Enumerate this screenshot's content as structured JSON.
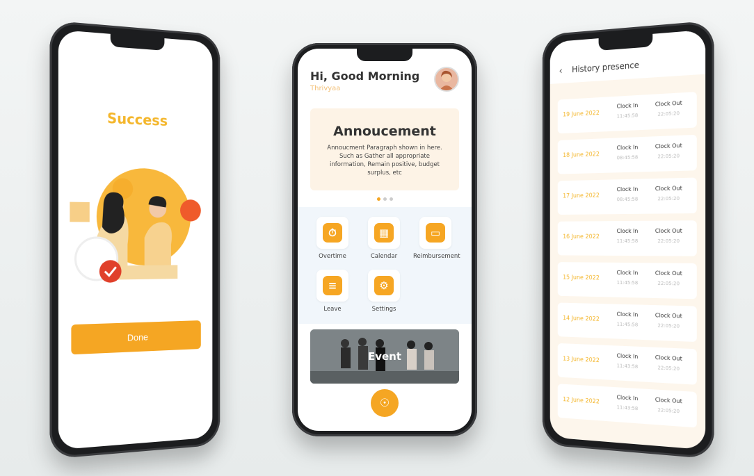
{
  "success_screen": {
    "title": "Success",
    "done_label": "Done"
  },
  "home_screen": {
    "greeting": "Hi, Good Morning",
    "user_name": "Thrivyaa",
    "announcement": {
      "title": "Annoucement",
      "text": "Annoucment Paragraph shown in here. Such as Gather all appropriate information, Remain positive, budget surplus, etc"
    },
    "menu": [
      {
        "label": "Overtime",
        "icon": "clock-plus-icon"
      },
      {
        "label": "Calendar",
        "icon": "calendar-icon"
      },
      {
        "label": "Reimbursement",
        "icon": "wallet-icon"
      },
      {
        "label": "Leave",
        "icon": "document-icon"
      },
      {
        "label": "Settings",
        "icon": "gear-icon"
      }
    ],
    "event_label": "Event"
  },
  "history_screen": {
    "title": "History presence",
    "clock_in_label": "Clock In",
    "clock_out_label": "Clock Out",
    "rows": [
      {
        "date": "19 June 2022",
        "in": "11:45:58",
        "out": "22:05:20"
      },
      {
        "date": "18 June 2022",
        "in": "08:45:58",
        "out": "22:05:20"
      },
      {
        "date": "17 June 2022",
        "in": "08:45:58",
        "out": "22:05:20"
      },
      {
        "date": "16 June 2022",
        "in": "11:45:58",
        "out": "22:05:20"
      },
      {
        "date": "15 June 2022",
        "in": "11:45:58",
        "out": "22:05:20"
      },
      {
        "date": "14 June 2022",
        "in": "11:45:58",
        "out": "22:05:20"
      },
      {
        "date": "13 June 2022",
        "in": "11:43:58",
        "out": "22:05:20"
      },
      {
        "date": "12 June 2022",
        "in": "11:43:58",
        "out": "22:05:20"
      }
    ]
  },
  "colors": {
    "accent": "#f5a623",
    "accent_text": "#f4b62b",
    "menu_bg": "#f1f6fb",
    "card_bg": "#fdf3e6"
  }
}
